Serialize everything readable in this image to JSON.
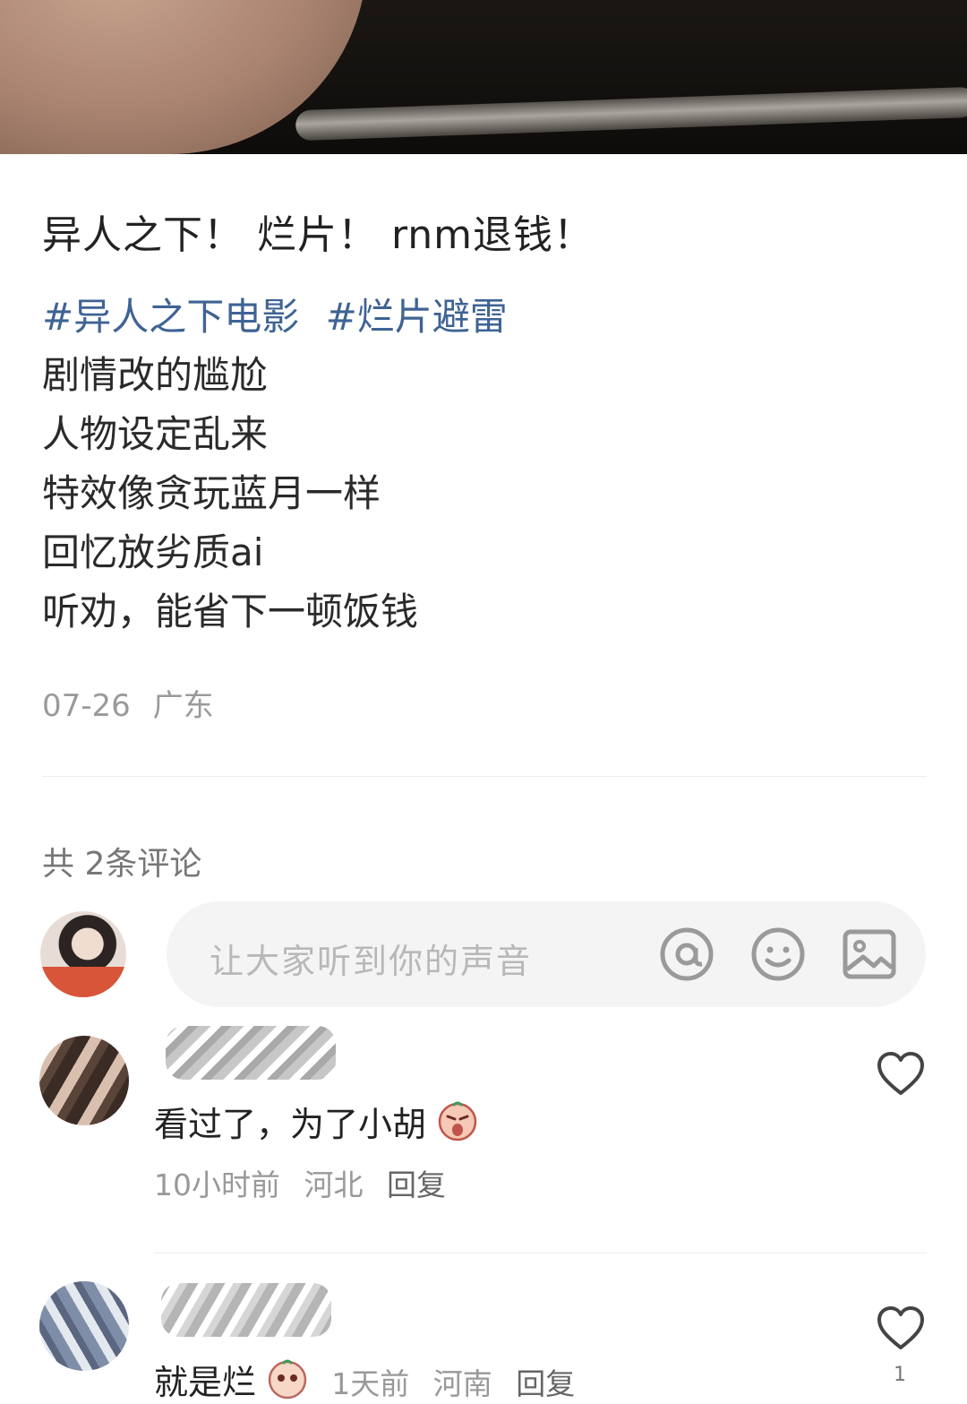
{
  "post": {
    "title": "异人之下！ 烂片！ rnm退钱！",
    "tags": [
      "#异人之下电影",
      "#烂片避雷"
    ],
    "lines": [
      "剧情改的尴尬",
      "人物设定乱来",
      "特效像贪玩蓝月一样",
      "回忆放劣质ai",
      "听劝，能省下一顿饭钱"
    ],
    "date": "07-26",
    "location": "广东"
  },
  "comments_header": "共 2条评论",
  "input": {
    "placeholder": "让大家听到你的声音"
  },
  "comments": [
    {
      "text": "看过了，为了小胡",
      "time": "10小时前",
      "location": "河北",
      "reply": "回复"
    },
    {
      "text": "就是烂",
      "time": "1天前",
      "location": "河南",
      "reply": "回复",
      "likes": "1"
    }
  ],
  "colors": {
    "tag": "#3f6394",
    "meta": "#9a9a9a"
  }
}
